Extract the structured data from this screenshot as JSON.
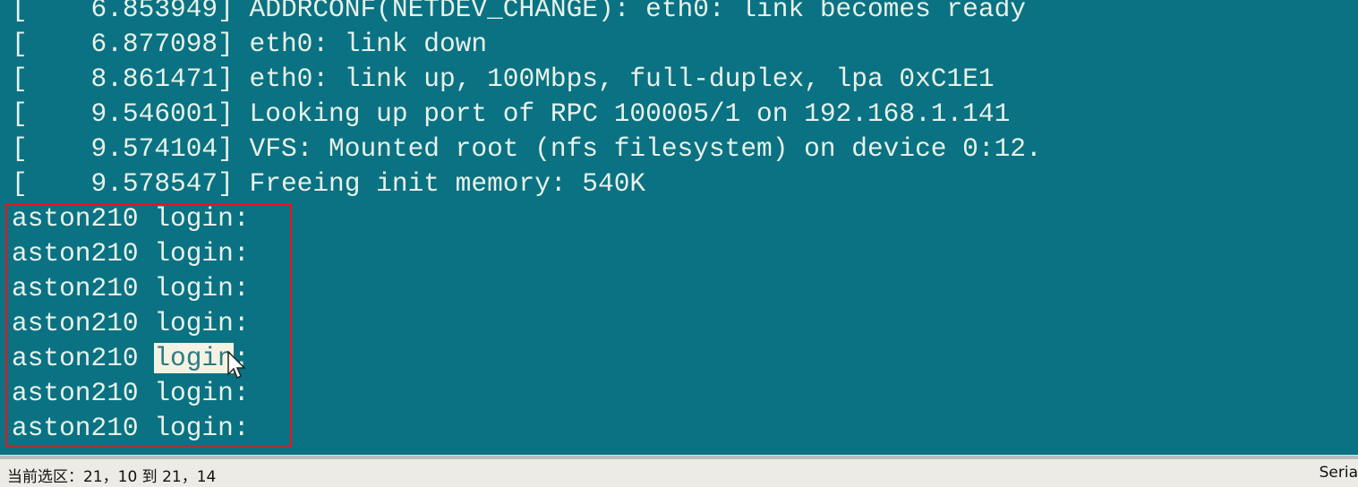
{
  "terminal": {
    "log_lines": [
      "[    6.853949] ADDRCONF(NETDEV_CHANGE): eth0: link becomes ready",
      "[    6.877098] eth0: link down",
      "[    8.861471] eth0: link up, 100Mbps, full-duplex, lpa 0xC1E1",
      "[    9.546001] Looking up port of RPC 100005/1 on 192.168.1.141",
      "[    9.574104] VFS: Mounted root (nfs filesystem) on device 0:12.",
      "[    9.578547] Freeing init memory: 540K"
    ],
    "login_prefix": "aston210 ",
    "login_word": "login",
    "login_suffix": ":",
    "login_count": 7,
    "selected_login_index": 4,
    "colors": {
      "background": "#0a7282",
      "text": "#e8f2ea",
      "highlight_box": "#e8141c"
    }
  },
  "status_bar": {
    "selection": "当前选区：21，10 到 21，14",
    "right_text": "Seria"
  }
}
